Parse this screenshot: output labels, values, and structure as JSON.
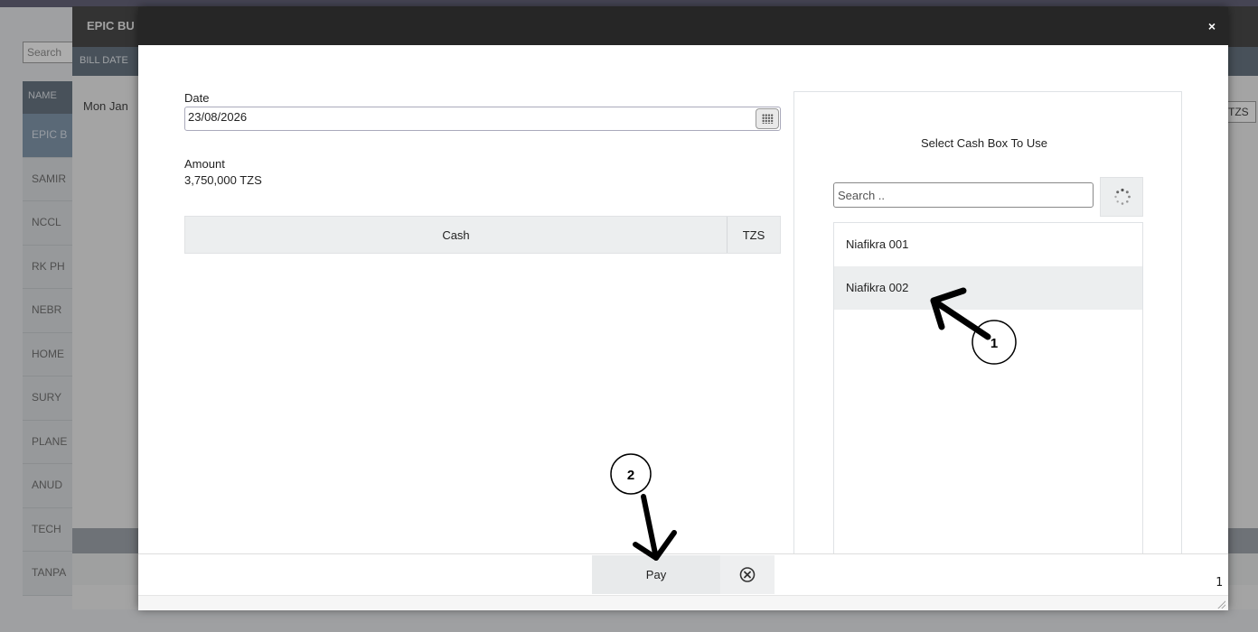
{
  "background": {
    "search_placeholder": "Search",
    "name_header": "NAME",
    "names": [
      "EPIC B",
      "SAMIR",
      "NCCL",
      "RK PH",
      "NEBR",
      "HOME",
      "SURY",
      "PLANE",
      "ANUD",
      "TECH",
      "TANPA"
    ],
    "dialog_title": "EPIC BU",
    "bill_date_header": "BILL DATE",
    "bill_date_value": "Mon Jan",
    "currency_field": "TZS"
  },
  "modal": {
    "close_label": "×",
    "date_label": "Date",
    "date_value": "23/08/2026",
    "amount_label": "Amount",
    "amount_value": "3,750,000 TZS",
    "payment_table": {
      "method": "Cash",
      "currency": "TZS"
    },
    "cash_box": {
      "title": "Select Cash Box To Use",
      "search_placeholder": "Search ..",
      "items": [
        "Niafikra 001",
        "Niafikra 002"
      ],
      "selected_index": 1
    },
    "footer": {
      "pay_label": "Pay",
      "page_number": "1"
    }
  },
  "annotations": {
    "step1": "1",
    "step2": "2"
  }
}
